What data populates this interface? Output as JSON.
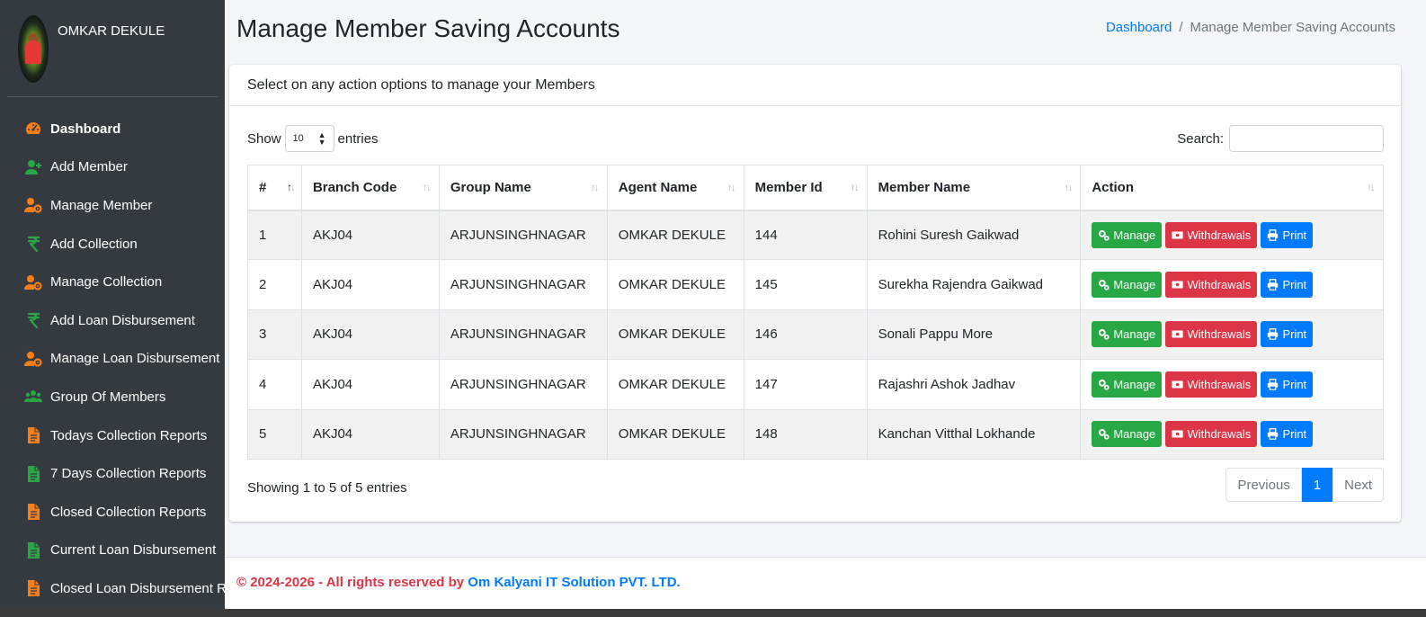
{
  "user": {
    "name": "OMKAR DEKULE"
  },
  "sidebar": {
    "items": [
      {
        "label": "Dashboard",
        "icon": "dashboard-gauge-icon",
        "color": "#fd7e14",
        "active": true
      },
      {
        "label": "Add Member",
        "icon": "user-plus-icon",
        "color": "#28a745"
      },
      {
        "label": "Manage Member",
        "icon": "user-gear-icon",
        "color": "#fd7e14"
      },
      {
        "label": "Add Collection",
        "icon": "rupee-icon",
        "color": "#28a745"
      },
      {
        "label": "Manage Collection",
        "icon": "user-gear-icon",
        "color": "#fd7e14"
      },
      {
        "label": "Add Loan Disbursement",
        "icon": "rupee-icon",
        "color": "#28a745"
      },
      {
        "label": "Manage Loan Disbursement",
        "icon": "user-gear-icon",
        "color": "#fd7e14"
      },
      {
        "label": "Group Of Members",
        "icon": "users-group-icon",
        "color": "#28a745"
      },
      {
        "label": "Todays Collection Reports",
        "icon": "file-icon",
        "color": "#fd7e14"
      },
      {
        "label": "7 Days Collection Reports",
        "icon": "file-icon",
        "color": "#28a745"
      },
      {
        "label": "Closed Collection Reports",
        "icon": "file-icon",
        "color": "#fd7e14"
      },
      {
        "label": "Current Loan Disbursement",
        "icon": "file-icon",
        "color": "#28a745"
      },
      {
        "label": "Closed Loan Disbursement R",
        "icon": "file-icon",
        "color": "#fd7e14"
      }
    ]
  },
  "header": {
    "title": "Manage Member Saving Accounts",
    "breadcrumb_home": "Dashboard",
    "breadcrumb_sep": "/",
    "breadcrumb_current": "Manage Member Saving Accounts"
  },
  "card": {
    "header": "Select on any action options to manage your Members",
    "show_label": "Show",
    "entries_value": "10",
    "entries_label": "entries",
    "search_label": "Search:",
    "search_value": "",
    "info": "Showing 1 to 5 of 5 entries",
    "pagination": {
      "previous": "Previous",
      "current": "1",
      "next": "Next"
    }
  },
  "table": {
    "columns": [
      "#",
      "Branch Code",
      "Group Name",
      "Agent Name",
      "Member Id",
      "Member Name",
      "Action"
    ],
    "rows": [
      [
        "1",
        "AKJ04",
        "ARJUNSINGHNAGAR",
        "OMKAR DEKULE",
        "144",
        "Rohini Suresh Gaikwad"
      ],
      [
        "2",
        "AKJ04",
        "ARJUNSINGHNAGAR",
        "OMKAR DEKULE",
        "145",
        "Surekha Rajendra Gaikwad"
      ],
      [
        "3",
        "AKJ04",
        "ARJUNSINGHNAGAR",
        "OMKAR DEKULE",
        "146",
        "Sonali Pappu More"
      ],
      [
        "4",
        "AKJ04",
        "ARJUNSINGHNAGAR",
        "OMKAR DEKULE",
        "147",
        "Rajashri Ashok Jadhav"
      ],
      [
        "5",
        "AKJ04",
        "ARJUNSINGHNAGAR",
        "OMKAR DEKULE",
        "148",
        "Kanchan Vitthal Lokhande"
      ]
    ],
    "actions": {
      "manage": "Manage",
      "withdrawals": "Withdrawals",
      "print": "Print"
    }
  },
  "footer": {
    "copyright": "© 2024-2026 - All rights reserved by",
    "company": "Om Kalyani IT Solution PVT. LTD."
  },
  "colors": {
    "sidebar_bg": "#343a40",
    "primary": "#007bff",
    "success": "#28a745",
    "danger": "#dc3545",
    "orange": "#fd7e14"
  }
}
